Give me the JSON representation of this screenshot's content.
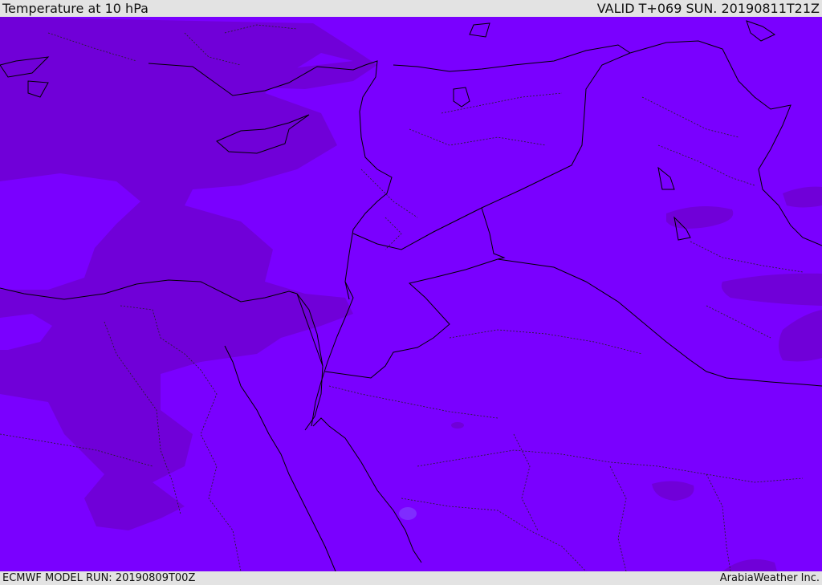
{
  "header": {
    "title": "Temperature at 10 hPa",
    "valid_time": "VALID T+069 SUN. 20190811T21Z"
  },
  "footer": {
    "model_run": "ECMWF MODEL RUN: 20190809T00Z",
    "credit": "ArabiaWeather Inc."
  },
  "map": {
    "colors": {
      "field_base": "#7a00ff",
      "field_warm": "#7000d8",
      "field_warmer": "#6a00c8",
      "field_cool": "#7f2cff",
      "borders": "#000000"
    }
  }
}
